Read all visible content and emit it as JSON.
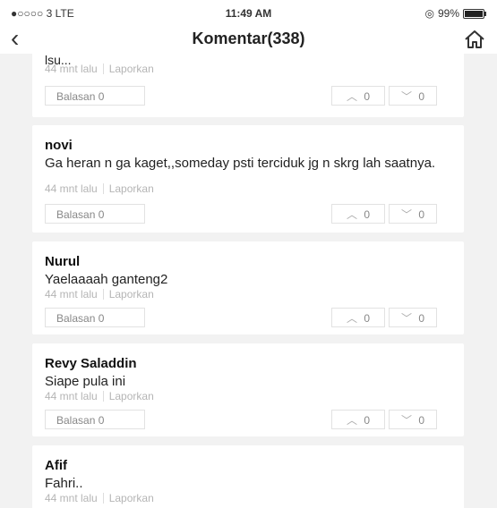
{
  "status_bar": {
    "carrier": "●○○○○ 3  LTE",
    "time": "11:49 AM",
    "battery": "99%",
    "battery_level": 0.99
  },
  "nav": {
    "title": "Komentar(338)"
  },
  "actions": {
    "time_ago": "44 mnt lalu",
    "report": "Laporkan",
    "reply_prefix": "Balasan",
    "up_arrow": "︿",
    "down_arrow": "﹀"
  },
  "comments": [
    {
      "name": "",
      "text": "",
      "partial_text": "lsu...",
      "reply_count": "0",
      "up_count": "0",
      "down_count": "0"
    },
    {
      "name": "novi",
      "text": "Ga heran n ga kaget,,someday psti terciduk jg n skrg lah saatnya.",
      "reply_count": "0",
      "up_count": "0",
      "down_count": "0"
    },
    {
      "name": "Nurul",
      "text": "Yaelaaaah ganteng2",
      "reply_count": "0",
      "up_count": "0",
      "down_count": "0"
    },
    {
      "name": "Revy Saladdin",
      "text": "Siape pula ini",
      "reply_count": "0",
      "up_count": "0",
      "down_count": "0"
    },
    {
      "name": "Afif",
      "text": "Fahri..",
      "reply_count": "",
      "up_count": "",
      "down_count": ""
    }
  ]
}
